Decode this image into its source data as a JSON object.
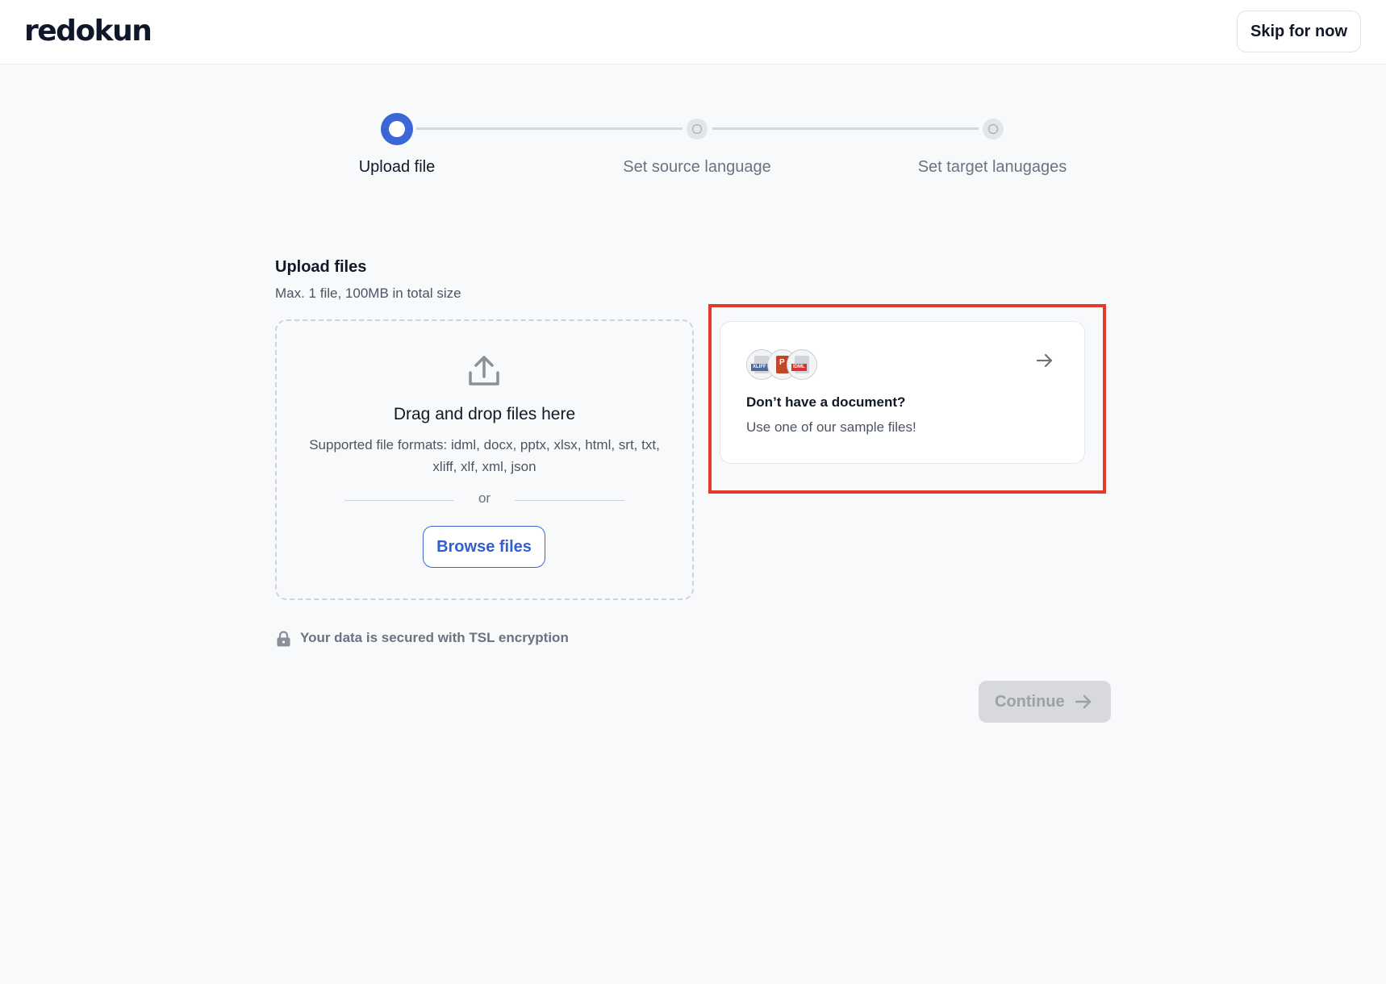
{
  "header": {
    "logo": "redokun",
    "skip_label": "Skip for now"
  },
  "stepper": {
    "steps": [
      {
        "label": "Upload file",
        "active": true
      },
      {
        "label": "Set source language",
        "active": false
      },
      {
        "label": "Set target lanugages",
        "active": false
      }
    ]
  },
  "upload": {
    "title": "Upload files",
    "subtitle": "Max. 1 file, 100MB in total size",
    "drag_title": "Drag and drop files here",
    "formats": "Supported file formats: idml, docx, pptx, xlsx, html, srt, txt, xliff, xlf, xml, json",
    "or": "or",
    "browse_label": "Browse files"
  },
  "sample": {
    "title": "Don’t have a document?",
    "subtitle": "Use one of our sample files!",
    "file_tags": [
      "XLIFF",
      "P",
      "IDML"
    ],
    "tag_colors": [
      "#4b6a9b",
      "#c0462a",
      "#d6322e"
    ]
  },
  "security": {
    "text": "Your data is secured with TSL encryption",
    "icon": "lock-icon"
  },
  "footer": {
    "continue_label": "Continue"
  },
  "colors": {
    "accent": "#3b67d6",
    "highlight": "#e33b2a"
  }
}
